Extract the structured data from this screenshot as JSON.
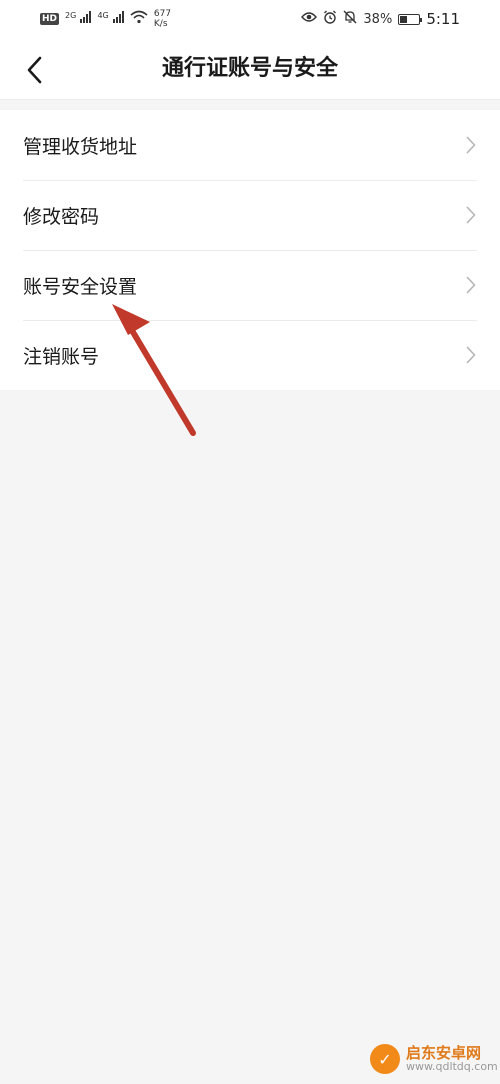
{
  "status_bar": {
    "hd": "HD",
    "net1": "2G",
    "net2": "4G",
    "speed_value": "677",
    "speed_unit": "K/s",
    "battery": "38%",
    "battery_level": 0.38,
    "time": "5:11",
    "icons": [
      "eye-icon",
      "alarm-icon",
      "mute-bell-icon",
      "battery-icon"
    ]
  },
  "nav": {
    "title": "通行证账号与安全",
    "back_icon": "chevron-left-icon"
  },
  "menu": {
    "items": [
      {
        "label": "管理收货地址"
      },
      {
        "label": "修改密码"
      },
      {
        "label": "账号安全设置"
      },
      {
        "label": "注销账号"
      }
    ]
  },
  "annotation": {
    "arrow_color": "#c0392b"
  },
  "watermark": {
    "name": "启东安卓网",
    "url": "www.qdltdq.com"
  }
}
